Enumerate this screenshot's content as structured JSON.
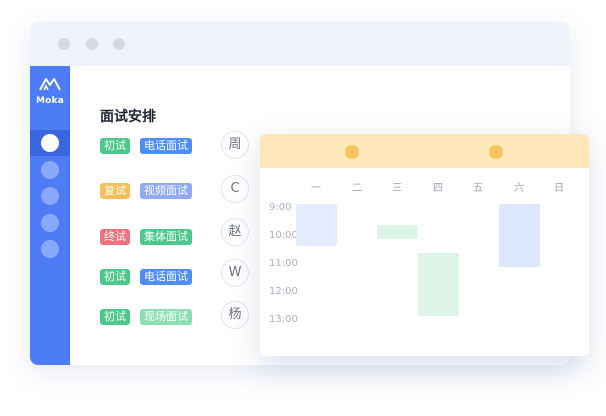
{
  "brand": {
    "name": "Moka"
  },
  "section_title": "面试安排",
  "schedule": [
    {
      "stage": "初试",
      "stage_color": "#4cc98a",
      "method": "电话面试",
      "method_color": "#4c8df6",
      "avatar": "周"
    },
    {
      "stage": "复试",
      "stage_color": "#f7bf5a",
      "method": "视频面试",
      "method_color": "#8fa9f6",
      "avatar": "C"
    },
    {
      "stage": "终试",
      "stage_color": "#f0727f",
      "method": "集体面试",
      "method_color": "#4cc98a",
      "avatar": "赵"
    },
    {
      "stage": "初试",
      "stage_color": "#4cc98a",
      "method": "电话面试",
      "method_color": "#4c8df6",
      "avatar": "W"
    },
    {
      "stage": "初试",
      "stage_color": "#4cc98a",
      "method": "现场面试",
      "method_color": "#8be0b3",
      "avatar": "杨"
    }
  ],
  "calendar": {
    "weekdays": [
      "一",
      "二",
      "三",
      "四",
      "五",
      "六",
      "日"
    ],
    "times": [
      "9:00",
      "10:00",
      "11:00",
      "12:00",
      "13:00"
    ],
    "events": [
      {
        "day": "一",
        "start": "9:00",
        "end": "10:30",
        "color": "#e4ebfd"
      },
      {
        "day": "三",
        "start": "9:45",
        "end": "10:15",
        "color": "#dcf5e8"
      },
      {
        "day": "四",
        "start": "10:45",
        "end": "13:00",
        "color": "#dcf5e8"
      },
      {
        "day": "六",
        "start": "9:00",
        "end": "11:15",
        "color": "#dce6fd"
      }
    ]
  }
}
